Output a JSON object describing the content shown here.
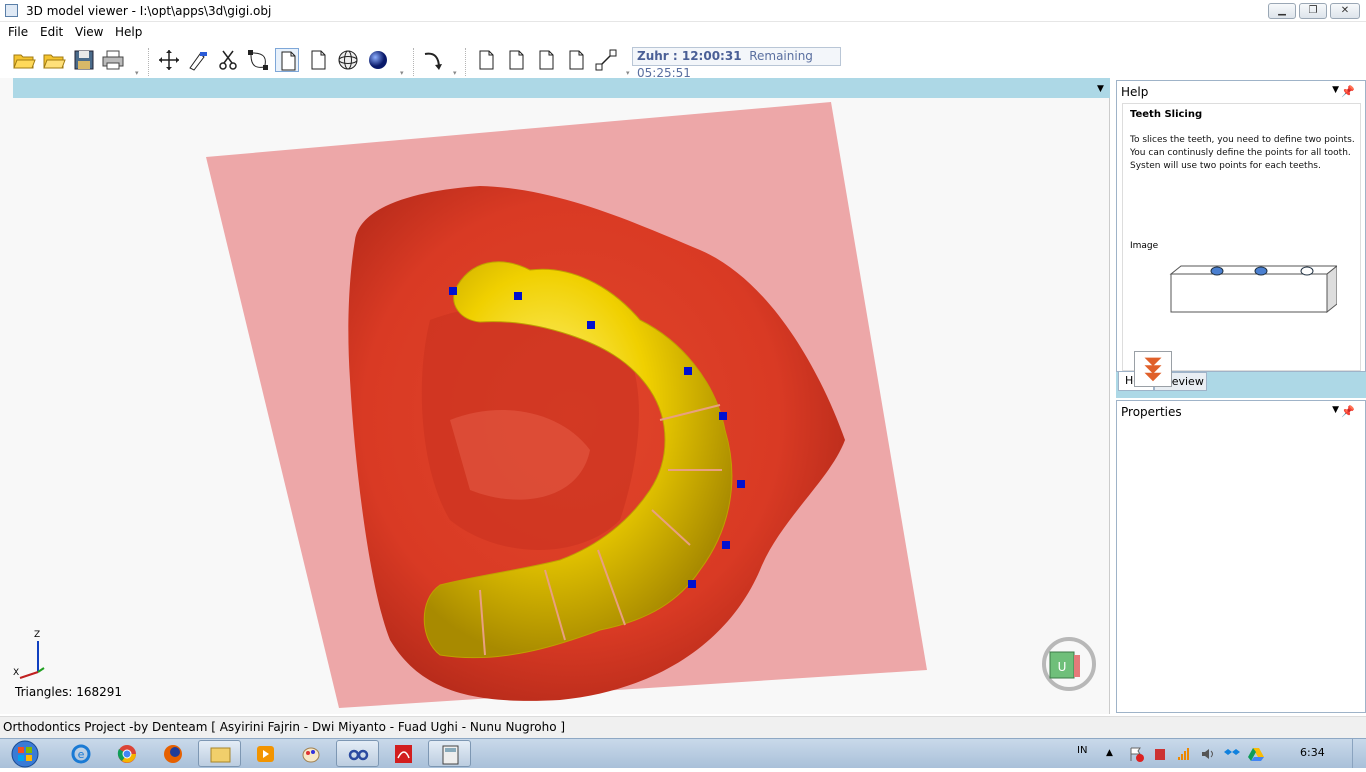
{
  "window": {
    "title": "3D model viewer - I:\\opt\\apps\\3d\\gigi.obj",
    "minimize_label": "▁",
    "maximize_label": "❐",
    "close_label": "✕"
  },
  "menu": [
    "File",
    "Edit",
    "View",
    "Help"
  ],
  "toolbar": {
    "icons": [
      "open-folder-icon",
      "open-icon",
      "save-icon",
      "print-icon",
      "move-icon",
      "pen-tool-icon",
      "scissors-icon",
      "bezier-icon",
      "document-icon",
      "document-icon",
      "sphere-wire-icon",
      "sphere-shaded-icon",
      "curve-arrow-icon",
      "document-icon",
      "document-icon",
      "document-icon",
      "document-icon",
      "resize-icon"
    ],
    "timer_prayer": "Zuhr : 12:00:31",
    "timer_remaining": "Remaining 05:25:51"
  },
  "viewport": {
    "triangles_label": "Triangles: 168291",
    "axis_z": "Z",
    "axis_x": "X",
    "menu_arrow": "▼"
  },
  "help_panel": {
    "header": "Help",
    "pin": "📌",
    "dropdown": "▼",
    "title": "Teeth Slicing",
    "lines": [
      "To slices the teeth, you need to define two points.",
      "You can continusly define the points for all tooth.",
      "Systen will use two points for each teeths."
    ],
    "image_label": "Image",
    "tabs": [
      "Help",
      "Preview"
    ]
  },
  "properties_panel": {
    "header": "Properties",
    "pin": "📌",
    "dropdown": "▼"
  },
  "statusbar": {
    "text": "Orthodontics Project -by Denteam [ Asyirini Fajrin - Dwi Miyanto - Fuad Ughi - Nunu Nugroho ]"
  },
  "taskbar": {
    "apps": [
      "internet-explorer-icon",
      "chrome-icon",
      "firefox-icon",
      "file-explorer-icon",
      "media-player-icon",
      "paint-icon",
      "viewer-app-icon",
      "acrobat-icon",
      "calculator-icon"
    ],
    "language": "IN",
    "tray_arrow": "▲",
    "clock": "6:34"
  }
}
